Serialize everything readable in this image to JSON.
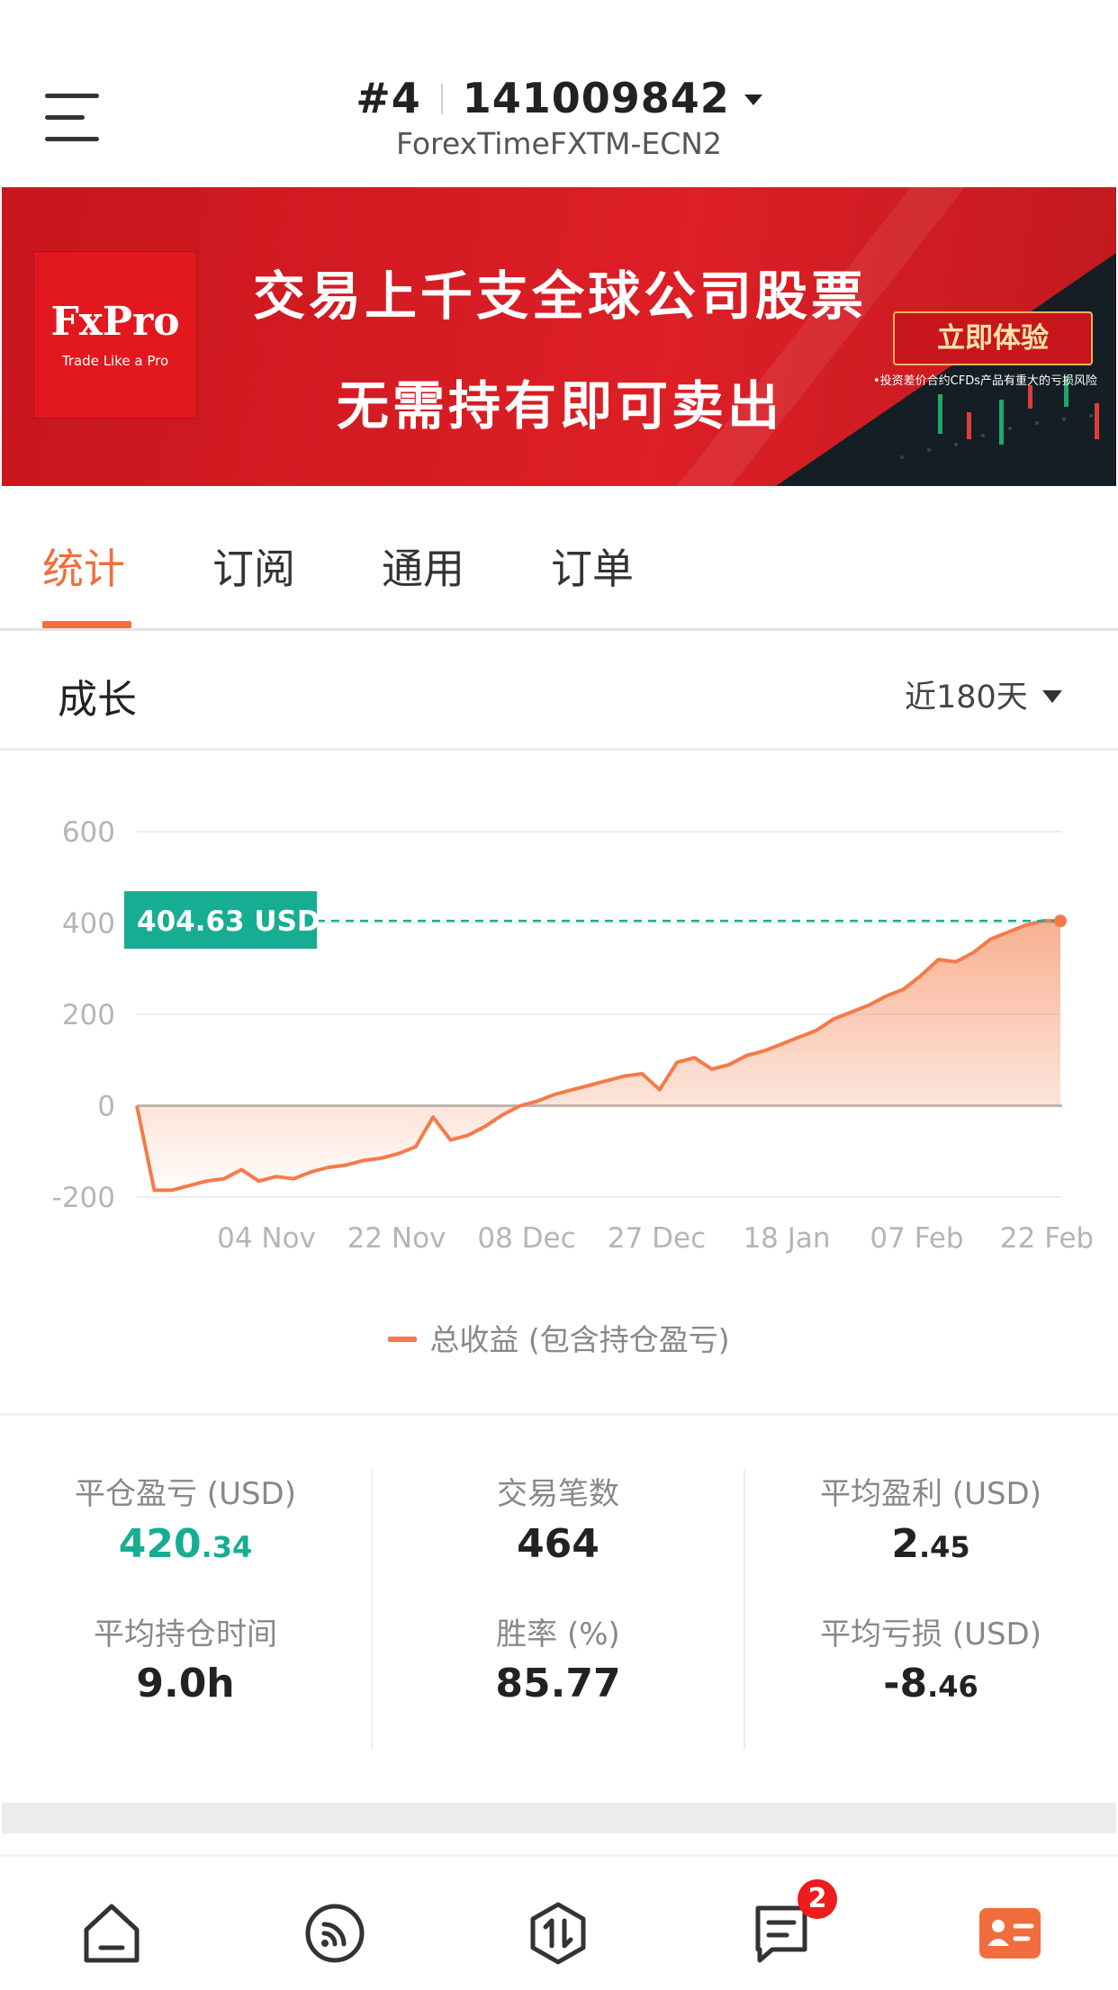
{
  "header": {
    "account_index": "#4",
    "account_number": "141009842",
    "server": "ForexTimeFXTM-ECN2"
  },
  "banner": {
    "logo_brand": "FxPro",
    "logo_tagline": "Trade Like a Pro",
    "headline_1": "交易上千支全球公司股票",
    "headline_2": "无需持有即可卖出",
    "cta_label": "立即体验",
    "risk_note": "•投资差价合约CFDs产品有重大的亏损风险"
  },
  "tabs": [
    {
      "label": "统计",
      "active": true
    },
    {
      "label": "订阅",
      "active": false
    },
    {
      "label": "通用",
      "active": false
    },
    {
      "label": "订单",
      "active": false
    }
  ],
  "section": {
    "title": "成长",
    "period": "近180天"
  },
  "chart_data": {
    "type": "area",
    "x_tick_labels": [
      "04 Nov",
      "22 Nov",
      "08 Dec",
      "27 Dec",
      "18 Jan",
      "07 Feb",
      "22 Feb"
    ],
    "y_tick_labels": [
      "600",
      "400",
      "200",
      "0",
      "-200"
    ],
    "ylim": [
      -200,
      600
    ],
    "grid": true,
    "current_value_label": "404.63 USD",
    "current_value": 404.63,
    "series": [
      {
        "name": "总收益 (包含持仓盈亏)",
        "color": "#f47b49",
        "x_index": [
          0,
          1,
          2,
          3,
          4,
          5,
          6,
          7,
          8,
          9,
          10,
          11,
          12,
          13,
          14,
          15,
          16,
          17,
          18,
          19,
          20,
          21,
          22,
          23,
          24,
          25,
          26,
          27,
          28,
          29,
          30,
          31,
          32,
          33,
          34,
          35,
          36,
          37,
          38,
          39,
          40,
          41,
          42,
          43,
          44,
          45,
          46,
          47,
          48,
          49,
          50,
          51,
          52,
          53,
          54,
          55,
          56,
          57,
          58,
          59,
          60
        ],
        "values": [
          0,
          -185,
          -185,
          -175,
          -165,
          -160,
          -140,
          -165,
          -155,
          -160,
          -145,
          -135,
          -130,
          -120,
          -115,
          -105,
          -90,
          -25,
          -75,
          -65,
          -45,
          -20,
          0,
          10,
          25,
          35,
          45,
          55,
          65,
          70,
          35,
          95,
          105,
          80,
          90,
          110,
          120,
          135,
          150,
          165,
          190,
          205,
          220,
          240,
          255,
          285,
          320,
          315,
          335,
          365,
          380,
          395,
          405,
          404.63,
          404.63,
          404.63,
          404.63,
          404.63,
          404.63,
          404.63,
          404.63
        ]
      }
    ],
    "legend": "总收益 (包含持仓盈亏)"
  },
  "stats": {
    "closed_pl": {
      "label": "平仓盈亏 (USD)",
      "int": "420",
      "dec": ".34"
    },
    "trades": {
      "label": "交易笔数",
      "value": "464"
    },
    "avg_profit": {
      "label": "平均盈利 (USD)",
      "int": "2",
      "dec": ".45"
    },
    "avg_hold": {
      "label": "平均持仓时间",
      "value": "9.0h"
    },
    "win_rate": {
      "label": "胜率 (%)",
      "value": "85.77"
    },
    "avg_loss": {
      "label": "平均亏损 (USD)",
      "int": "-8",
      "dec": ".46"
    }
  },
  "nav": {
    "items": [
      "home-icon",
      "signal-icon",
      "trade-icon",
      "messages-icon",
      "profile-card-icon"
    ],
    "messages_badge": "2",
    "active_color": "#f26d3d"
  }
}
